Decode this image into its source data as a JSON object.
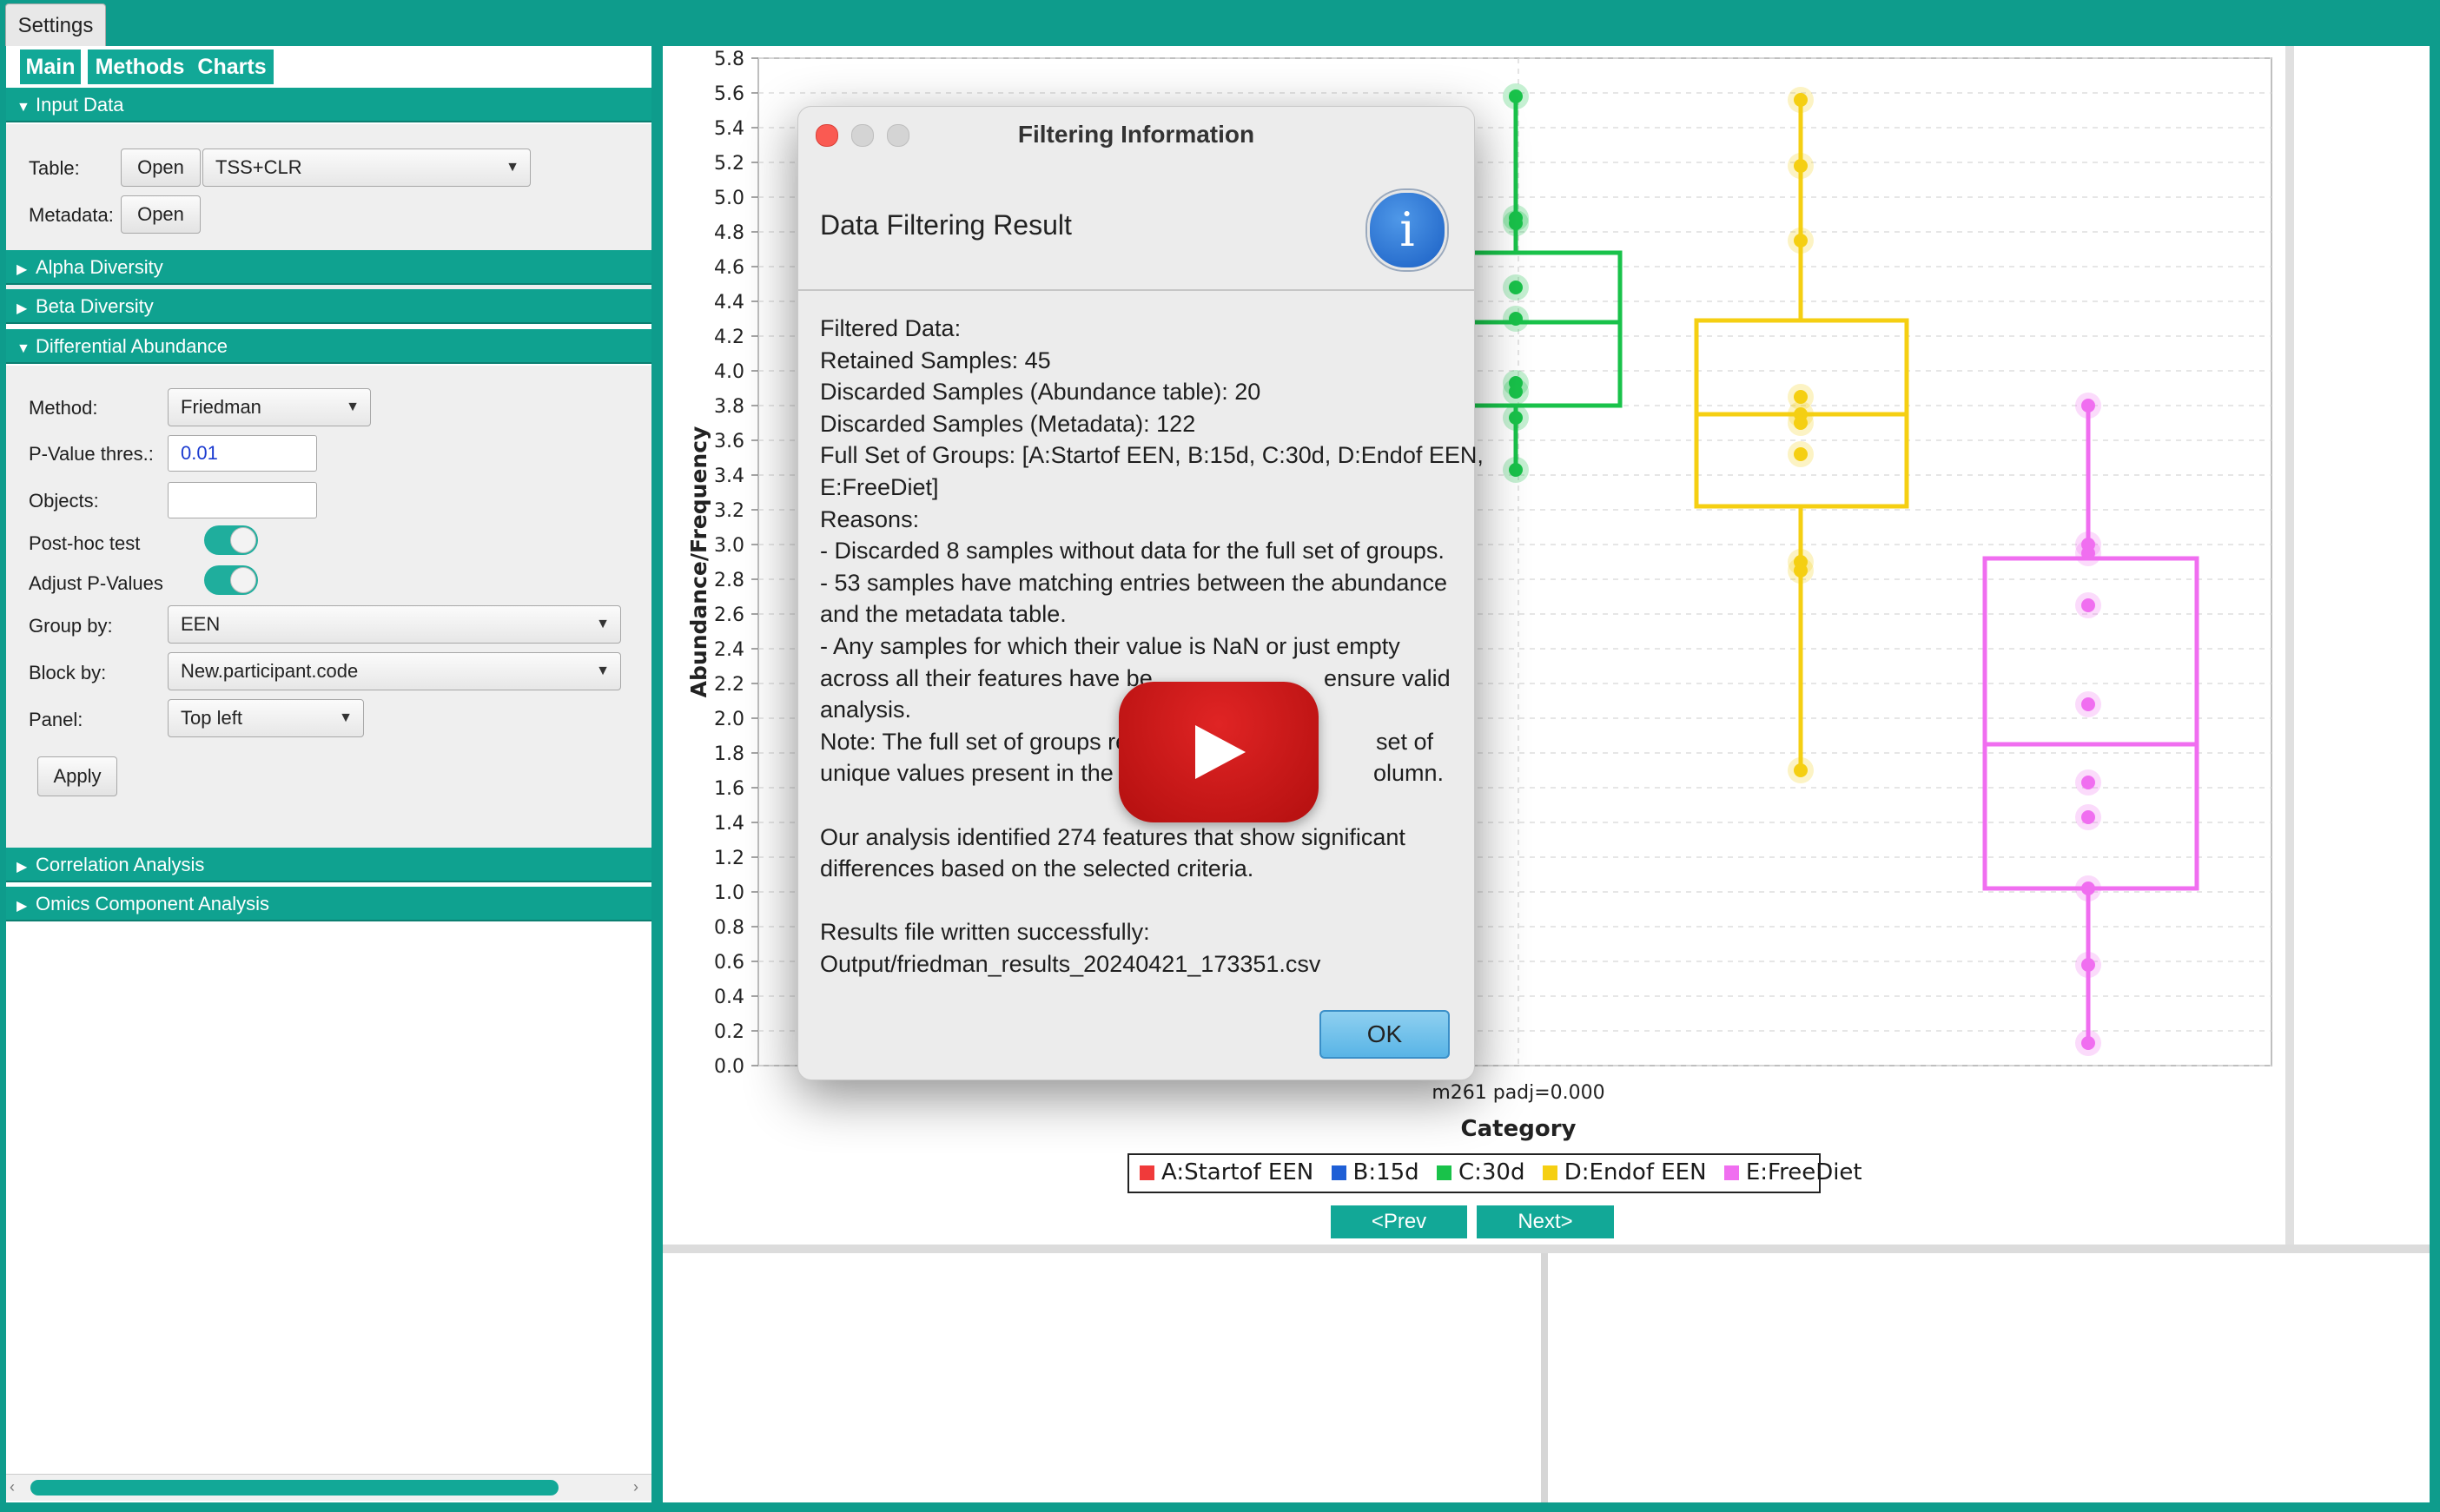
{
  "window": {
    "tab_label": "Settings",
    "accent_color": "#0e9c8c"
  },
  "nav": {
    "main": "Main",
    "methods": "Methods",
    "charts": "Charts"
  },
  "sections": {
    "input_data": "Input Data",
    "alpha_diversity": "Alpha Diversity",
    "beta_diversity": "Beta Diversity",
    "differential_abundance": "Differential Abundance",
    "correlation_analysis": "Correlation Analysis",
    "omics_component_analysis": "Omics Component Analysis"
  },
  "input_data": {
    "table_label": "Table:",
    "open_label": "Open",
    "table_value": "TSS+CLR",
    "metadata_label": "Metadata:",
    "metadata_open_label": "Open"
  },
  "diff_abundance": {
    "method_label": "Method:",
    "method_value": "Friedman",
    "pvalue_label": "P-Value thres.:",
    "pvalue_value": "0.01",
    "objects_label": "Objects:",
    "objects_value": "",
    "posthoc_label": "Post-hoc test",
    "posthoc_on": true,
    "adjust_label": "Adjust P-Values",
    "adjust_on": true,
    "groupby_label": "Group by:",
    "groupby_value": "EEN",
    "blockby_label": "Block by:",
    "blockby_value": "New.participant.code",
    "panel_label": "Panel:",
    "panel_value": "Top left",
    "apply_label": "Apply"
  },
  "dialog": {
    "title": "Filtering Information",
    "heading": "Data Filtering Result",
    "icon": "info-icon",
    "lines": [
      "Filtered Data:",
      "Retained Samples: 45",
      "Discarded Samples (Abundance table): 20",
      "Discarded Samples (Metadata): 122",
      "Full Set of Groups: [A:Startof EEN, B:15d, C:30d, D:Endof EEN,",
      "E:FreeDiet]",
      "Reasons:",
      "- Discarded 8 samples without data for the full set of groups.",
      "- 53 samples have matching entries between the abundance",
      "and the metadata table.",
      "- Any samples for which their value is NaN or just empty",
      "across all their features have be",
      "analysis.",
      "Note: The full set of groups re",
      "unique values present in the s",
      "",
      "Our analysis identified 274 features that show significant",
      "differences based on the selected criteria.",
      "",
      "Results file written successfully:",
      "Output/friedman_results_20240421_173351.csv"
    ],
    "line_tails": {
      "11": "ensure valid",
      "13": "set of",
      "14": "olumn."
    },
    "ok_label": "OK"
  },
  "chart_data": {
    "type": "box",
    "xlabel": "Category",
    "ylabel": "Abundance/Frequency",
    "x_tick": "m261 padj=0.000",
    "ylim": [
      0.0,
      5.8
    ],
    "yticks": [
      "0.0",
      "0.2",
      "0.4",
      "0.6",
      "0.8",
      "1.0",
      "1.2",
      "1.4",
      "1.6",
      "1.8",
      "2.0",
      "2.2",
      "2.4",
      "2.6",
      "2.8",
      "3.0",
      "3.2",
      "3.4",
      "3.6",
      "3.8",
      "4.0",
      "4.2",
      "4.4",
      "4.6",
      "4.8",
      "5.0",
      "5.2",
      "5.4",
      "5.6",
      "5.8"
    ],
    "grid": true,
    "legend": [
      {
        "name": "A:Startof EEN",
        "color": "#f03a3a"
      },
      {
        "name": "B:15d",
        "color": "#1f5fd6"
      },
      {
        "name": "C:30d",
        "color": "#19c24a"
      },
      {
        "name": "D:Endof EEN",
        "color": "#f5cf12"
      },
      {
        "name": "E:FreeDiet",
        "color": "#f06ef0"
      }
    ],
    "series": [
      {
        "name": "C:30d",
        "color": "#19c24a",
        "center": 3.8,
        "q1": 3.8,
        "median": 4.28,
        "q3": 4.68,
        "whisker_low": 3.43,
        "whisker_high": 5.58,
        "points": [
          5.58,
          4.88,
          4.85,
          4.48,
          4.3,
          3.93,
          3.88,
          3.73,
          3.43
        ],
        "box_left": 3.5
      },
      {
        "name": "D:Endof EEN",
        "color": "#f5cf12",
        "q1": 3.22,
        "median": 3.75,
        "q3": 4.29,
        "whisker_low": 1.7,
        "whisker_high": 5.56,
        "points": [
          5.56,
          5.18,
          4.75,
          3.85,
          3.75,
          3.7,
          3.52,
          2.9,
          2.85,
          1.7
        ]
      },
      {
        "name": "E:FreeDiet",
        "color": "#f06ef0",
        "q1": 1.02,
        "median": 1.85,
        "q3": 2.92,
        "whisker_low": 0.13,
        "whisker_high": 3.8,
        "points": [
          3.8,
          3.0,
          2.95,
          2.65,
          2.08,
          1.63,
          1.43,
          1.02,
          0.58,
          0.13
        ]
      }
    ]
  },
  "pager": {
    "prev": "<Prev",
    "next": "Next>"
  }
}
